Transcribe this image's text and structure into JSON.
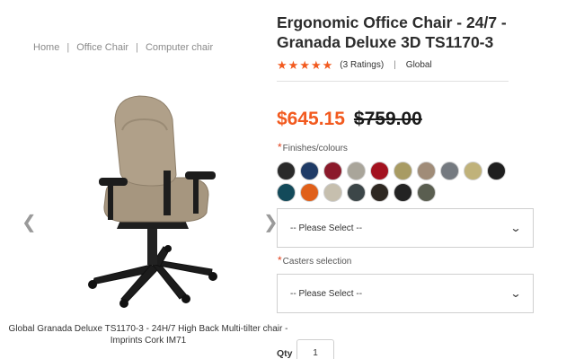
{
  "breadcrumb": {
    "home": "Home",
    "sep": "|",
    "category": "Office Chair",
    "sub": "Computer chair"
  },
  "product": {
    "title": "Ergonomic Office Chair - 24/7 - Granada Deluxe 3D TS1170-3",
    "rating_count": "(3 Ratings)",
    "rating_sep": "|",
    "brand": "Global",
    "stars": 5,
    "price_current": "$645.15",
    "price_old": "$759.00",
    "image_caption": "Global Granada Deluxe TS1170-3 - 24H/7 High Back Multi-tilter chair - Imprints Cork IM71"
  },
  "options": {
    "required_mark": "*",
    "finishes_label": "Finishes/colours",
    "swatch_colors": [
      "#2a2a2a",
      "#1f3b66",
      "#8b1a2b",
      "#a9a59a",
      "#a3121f",
      "#a89b63",
      "#a08c78",
      "#757a80",
      "#c0b27a",
      "#1e1e1e",
      "#134a5a",
      "#e0601a",
      "#c6bfae",
      "#3c4648",
      "#2e2822",
      "#232323",
      "#5a5e50"
    ],
    "finishes_select": "-- Please Select --",
    "casters_label": "Casters selection",
    "casters_select": "-- Please Select --",
    "qty_label": "Qty",
    "qty_value": "1"
  },
  "icons": {
    "star": "star-icon",
    "prev": "chevron-left-icon",
    "next": "chevron-right-icon",
    "dropdown": "chevron-down-icon"
  },
  "colors": {
    "accent": "#f25a1f"
  }
}
